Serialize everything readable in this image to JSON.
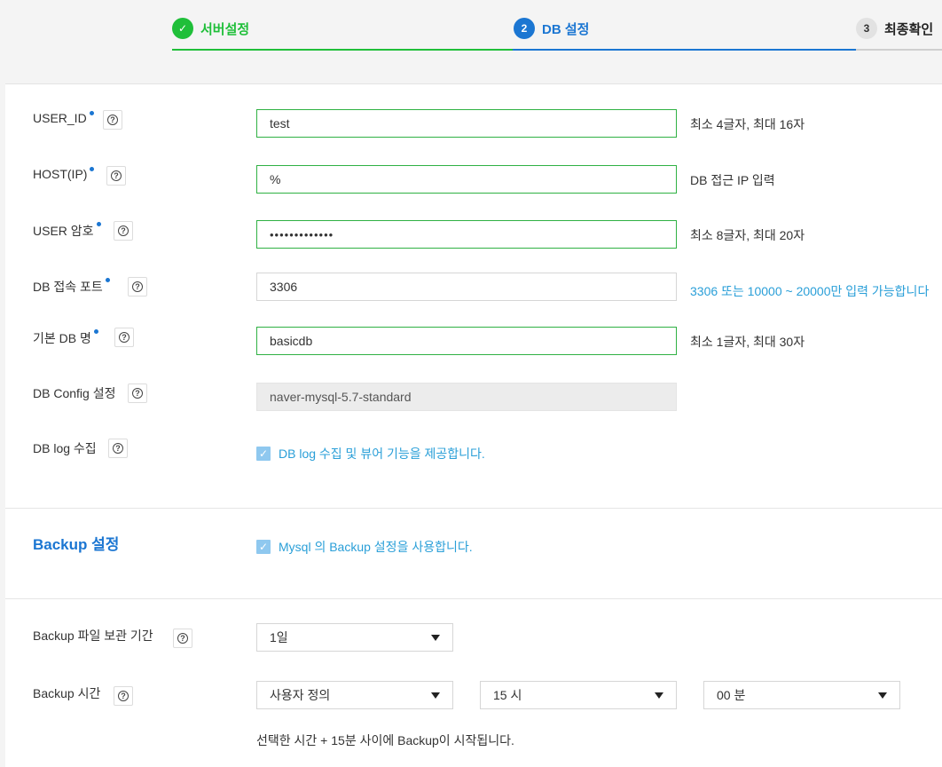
{
  "stepper": {
    "steps": [
      {
        "badge": "✓",
        "label": "서버설정",
        "state": "done"
      },
      {
        "badge": "2",
        "label": "DB 설정",
        "state": "active"
      },
      {
        "badge": "3",
        "label": "최종확인",
        "state": "pending"
      }
    ]
  },
  "form": {
    "user_id": {
      "label": "USER_ID",
      "value": "test",
      "hint": "최소 4글자, 최대 16자"
    },
    "host": {
      "label": "HOST(IP)",
      "value": "%",
      "hint": "DB 접근 IP 입력"
    },
    "password": {
      "label": "USER 암호",
      "value": "•••••••••••••",
      "hint": "최소 8글자, 최대 20자"
    },
    "port": {
      "label": "DB 접속 포트",
      "value": "3306",
      "hint": "3306 또는 10000 ~ 20000만 입력 가능합니다"
    },
    "db_name": {
      "label": "기본 DB 명",
      "value": "basicdb",
      "hint": "최소 1글자, 최대 30자"
    },
    "db_config": {
      "label": "DB Config 설정",
      "value": "naver-mysql-5.7-standard"
    },
    "db_log": {
      "label": "DB log 수집",
      "checkbox_label": "DB log 수집 및 뷰어 기능을 제공합니다.",
      "checked": true
    }
  },
  "backup": {
    "title": "Backup 설정",
    "checkbox_label": "Mysql 의 Backup 설정을 사용합니다.",
    "checked": true,
    "retention": {
      "label": "Backup 파일 보관 기간",
      "value": "1일"
    },
    "time": {
      "label": "Backup 시간",
      "mode": "사용자 정의",
      "hour": "15 시",
      "minute": "00 분",
      "note": "선택한 시간 + 15분 사이에 Backup이 시작됩니다."
    }
  },
  "colors": {
    "success": "#1fbf39",
    "primary": "#1b76d2",
    "info": "#2a9fd8"
  },
  "icons": {
    "help": "question-circle-icon",
    "done": "check-icon",
    "dropdown": "caret-down-icon"
  }
}
